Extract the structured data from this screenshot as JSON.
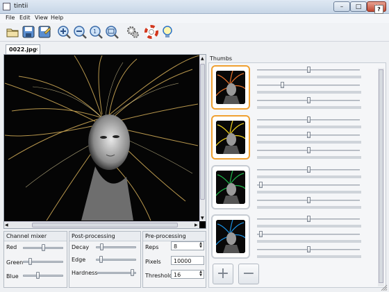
{
  "window": {
    "title": "tintii",
    "min": "–",
    "max": "□",
    "close": "✕"
  },
  "menu": [
    "File",
    "Edit",
    "View",
    "Help"
  ],
  "toolbar": {
    "icons": [
      "open-folder-icon",
      "save-icon",
      "save-as-icon",
      "zoom-in-icon",
      "zoom-out-icon",
      "zoom-actual-icon",
      "zoom-fit-icon",
      "settings-gears-icon",
      "help-lifebuoy-icon",
      "tip-lightbulb-icon"
    ],
    "help_label": "?"
  },
  "tab": {
    "label": "0022.jpg",
    "close": "✕"
  },
  "panels": {
    "channel_mixer": {
      "title": "Channel mixer",
      "sliders": [
        {
          "label": "Red",
          "value": 0.5
        },
        {
          "label": "Green",
          "value": 0.15
        },
        {
          "label": "Blue",
          "value": 0.35
        }
      ]
    },
    "post_processing": {
      "title": "Post-processing",
      "sliders": [
        {
          "label": "Decay",
          "value": 0.12
        },
        {
          "label": "Edge",
          "value": 0.1
        },
        {
          "label": "Hardness",
          "value": 0.95
        }
      ]
    },
    "pre_processing": {
      "title": "Pre-processing",
      "fields": [
        {
          "label": "Reps",
          "value": "8"
        },
        {
          "label": "Pixels",
          "value": "10000"
        },
        {
          "label": "Threshold",
          "value": "16"
        }
      ]
    }
  },
  "thumbs": {
    "title": "Thumbs",
    "items": [
      {
        "color": "#e8722a",
        "selected": true,
        "sliders": [
          0.5,
          0.24,
          0.5
        ]
      },
      {
        "color": "#f2d21e",
        "selected": true,
        "sliders": [
          0.5,
          0.5,
          0.5
        ]
      },
      {
        "color": "#1fb84a",
        "selected": false,
        "sliders": [
          0.5,
          0.02,
          0.5
        ]
      },
      {
        "color": "#1a8fe0",
        "selected": false,
        "sliders": [
          0.5,
          0.02,
          0.5
        ]
      }
    ],
    "add_label": "+",
    "remove_label": "−"
  },
  "colors": {
    "accent": "#f0a030",
    "hair": "#d9b25a"
  }
}
